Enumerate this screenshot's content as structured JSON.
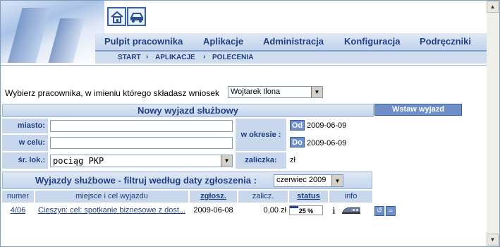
{
  "nav": {
    "items": [
      "Pulpit pracownika",
      "Aplikacje",
      "Administracja",
      "Konfiguracja",
      "Podręczniki"
    ]
  },
  "breadcrumb": [
    "START",
    "APLIKACJE",
    "POLECENIA"
  ],
  "employee": {
    "label": "Wybierz pracownika, w imieniu którego składasz wniosek",
    "selected": "Wojtarek Ilona"
  },
  "new_trip": {
    "title": "Nowy wyjazd służbowy",
    "city_label": "miasto:",
    "city_value": "",
    "purpose_label": "w celu:",
    "purpose_value": "",
    "transport_label": "śr. lok.:",
    "transport_value": "pociąg PKP",
    "period_label": "w okresie :",
    "from_label": "Od",
    "from_value": "2009-06-09",
    "to_label": "Do",
    "to_value": "2009-06-09",
    "advance_label": "zaliczka:",
    "advance_value": "zł",
    "insert_button": "Wstaw wyjazd"
  },
  "filter": {
    "title": "Wyjazdy służbowe - filtruj według daty zgłoszenia :",
    "selected": "czerwiec 2009"
  },
  "table": {
    "headers": [
      "numer",
      "miejsce i cel wyjazdu",
      "zgłosz.",
      "zalicz.",
      "status",
      "info"
    ],
    "rows": [
      {
        "numer": "4/06",
        "opis": "Cieszyn: cel: spotkanie biznesowe z dost...",
        "zgloszenie": "2009-06-08",
        "zaliczka": "0,00 zł",
        "status": "25 %",
        "progress": 0.25,
        "info": "i"
      }
    ]
  },
  "colors": {
    "accent": "#1f3f87",
    "header_bg": "#c9d7ec",
    "button": "#6f8fc9"
  }
}
